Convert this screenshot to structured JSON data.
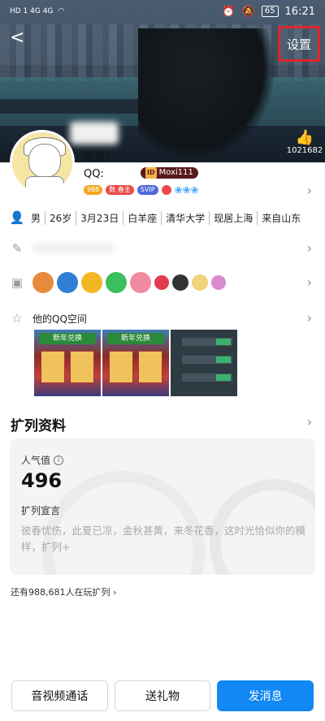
{
  "status": {
    "left": "HD 1  4G  4G",
    "battery": "65",
    "time": "16:21"
  },
  "header": {
    "back": "<",
    "settings_label": "设置"
  },
  "likes": {
    "count": "1021682"
  },
  "profile": {
    "nick_label": "昵称：",
    "qq_label": "QQ:",
    "qq_tag": "ID",
    "qq_id": "Moxi111",
    "badges": [
      "988",
      "数 春主",
      "SVIP",
      "",
      "❀❀❀"
    ]
  },
  "info": {
    "items": [
      "男",
      "26岁",
      "3月23日",
      "白羊座",
      "清华大学",
      "现居上海",
      "来自山东"
    ]
  },
  "qzone": {
    "title": "他的QQ空间",
    "banner": "新年兑换"
  },
  "card": {
    "section_title": "扩列资料",
    "popularity_label": "人气值",
    "popularity_value": "496",
    "declaration_label": "扩列宣言",
    "declaration_text": "彼春忧伤，此夏已凉，金秋甚黄，来冬花香，这时光恰似你的模样，扩列+"
  },
  "players_text": "还有988,681人在玩扩列",
  "bottom": {
    "call": "音视频通话",
    "gift": "送礼物",
    "message": "发消息"
  },
  "colors": {
    "accent": "#1188f3",
    "highlight_box": "#e0252b"
  }
}
